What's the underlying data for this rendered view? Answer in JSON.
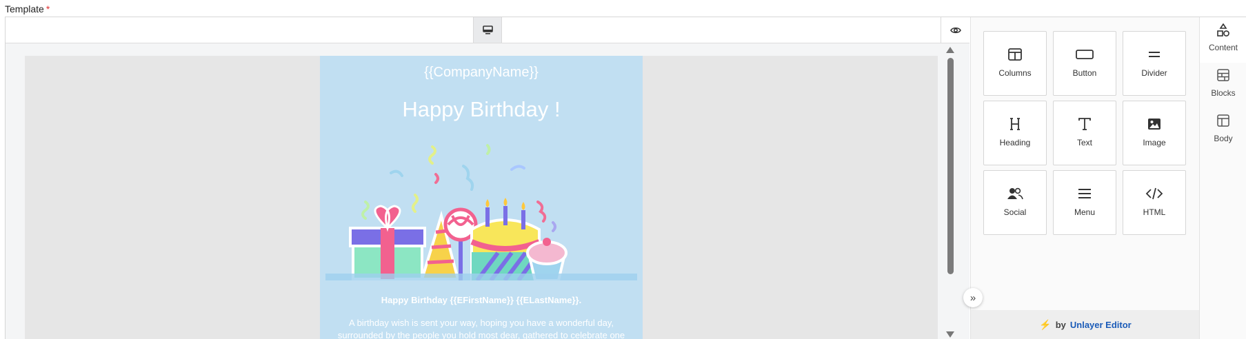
{
  "field": {
    "label": "Template",
    "required_mark": "*"
  },
  "toolbar": {
    "device_icon": "desktop-icon",
    "preview_icon": "eye-icon"
  },
  "email": {
    "company": "{{CompanyName}}",
    "headline": "Happy Birthday !",
    "greeting": "Happy Birthday {{EFirstName}} {{ELastName}}.",
    "body": "A birthday wish is sent your way, hoping you have a wonderful day, surrounded by the people you hold most dear, gathered to celebrate one",
    "background": "#c1dff2"
  },
  "tools": [
    {
      "label": "Columns",
      "icon": "columns-icon"
    },
    {
      "label": "Button",
      "icon": "button-icon"
    },
    {
      "label": "Divider",
      "icon": "divider-icon"
    },
    {
      "label": "Heading",
      "icon": "heading-icon"
    },
    {
      "label": "Text",
      "icon": "text-icon"
    },
    {
      "label": "Image",
      "icon": "image-icon"
    },
    {
      "label": "Social",
      "icon": "social-icon"
    },
    {
      "label": "Menu",
      "icon": "menu-icon"
    },
    {
      "label": "HTML",
      "icon": "code-icon"
    }
  ],
  "side_tabs": [
    {
      "label": "Content",
      "icon": "content-shapes-icon",
      "active": true
    },
    {
      "label": "Blocks",
      "icon": "blocks-icon",
      "active": false
    },
    {
      "label": "Body",
      "icon": "body-layout-icon",
      "active": false
    }
  ],
  "brand": {
    "by": "by",
    "name": "Unlayer Editor",
    "accent": "#1a5bb8",
    "bolt_color": "#f08c00"
  }
}
